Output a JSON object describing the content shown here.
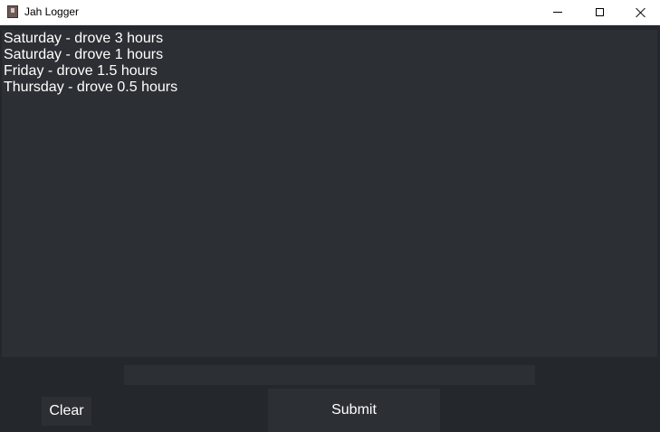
{
  "window": {
    "title": "Jah Logger",
    "icon": "app-icon",
    "controls": [
      "minimize-icon",
      "maximize-icon",
      "close-icon"
    ]
  },
  "log": {
    "lines": [
      "Saturday - drove 3 hours",
      "Saturday - drove 1 hours",
      "Friday - drove 1.5 hours",
      "Thursday - drove 0.5 hours"
    ]
  },
  "entry": {
    "value": "",
    "placeholder": ""
  },
  "buttons": {
    "clear_label": "Clear",
    "submit_label": "Submit"
  },
  "colors": {
    "background": "#24272b",
    "panel": "#2c2f34",
    "text": "#ffffff",
    "titlebar": "#ffffff"
  }
}
